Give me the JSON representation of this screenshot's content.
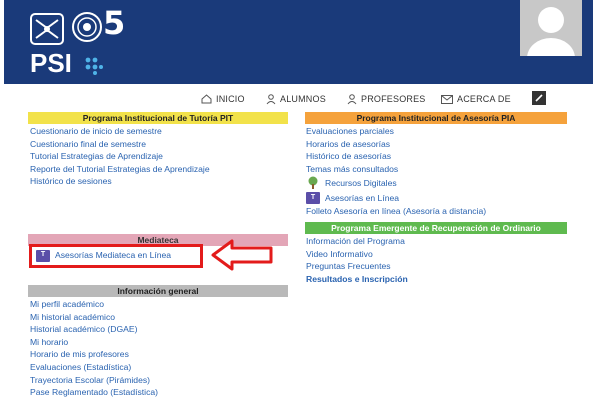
{
  "header": {
    "anniversary_number": "5",
    "psi_logo": "PSI",
    "avatar_icon": "user-silhouette-icon"
  },
  "nav": {
    "items": [
      {
        "label": "INICIO",
        "icon": "home-icon"
      },
      {
        "label": "ALUMNOS",
        "icon": "student-icon"
      },
      {
        "label": "PROFESORES",
        "icon": "teacher-icon"
      },
      {
        "label": "ACERCA DE",
        "icon": "info-icon"
      }
    ],
    "settings_icon": "pencil-icon"
  },
  "colors": {
    "header_bg": "#1a3a7a",
    "link": "#2a63b0",
    "yellow": "#f2e24a",
    "orange": "#f5a23c",
    "green": "#5fba4f",
    "pink": "#e3a6b7",
    "gray": "#b9b9b9",
    "highlight": "#e31b1b"
  },
  "pit": {
    "title": "Programa Institucional de Tutoría PIT",
    "links": [
      "Cuestionario de inicio de semestre",
      "Cuestionario final de semestre",
      "Tutorial Estrategias de Aprendizaje",
      "Reporte del Tutorial Estrategias de Aprendizaje",
      "Histórico de sesiones"
    ]
  },
  "pia": {
    "title": "Programa Institucional de Asesoría PIA",
    "links": [
      "Evaluaciones parciales",
      "Horarios de asesorías",
      "Histórico de asesorías",
      "Temas más consultados"
    ],
    "recursos": "Recursos Digitales",
    "asesorias_linea": "Asesorías en Línea",
    "folleto": "Folleto Asesoría en línea (Asesoría a distancia)"
  },
  "mediateca": {
    "title": "Mediateca",
    "link": "Asesorías Mediateca en Línea"
  },
  "emergente": {
    "title": "Programa Emergente de Recuperación de Ordinario",
    "links": [
      "Información del Programa",
      "Video Informativo",
      "Preguntas Frecuentes"
    ],
    "bold_link": "Resultados e Inscripción"
  },
  "general": {
    "title": "Información general",
    "links": [
      "Mi perfil académico",
      "Mi historial académico",
      "Historial académico (DGAE)",
      "Mi horario",
      "Horario de mis profesores",
      "Evaluaciones (Estadística)",
      "Trayectoria Escolar (Pirámides)",
      "Pase Reglamentado (Estadística)"
    ]
  }
}
